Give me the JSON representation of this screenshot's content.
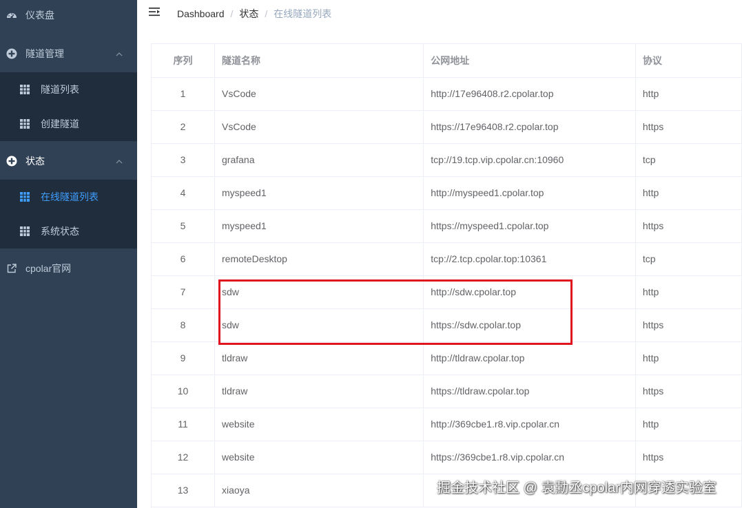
{
  "sidebar": {
    "dashboard": {
      "label": "仪表盘",
      "icon": "dashboard-icon"
    },
    "tunnel_mgmt": {
      "label": "隧道管理",
      "icon": "circle-plus-icon",
      "children": [
        {
          "label": "隧道列表",
          "icon": "table-icon"
        },
        {
          "label": "创建隧道",
          "icon": "table-icon"
        }
      ]
    },
    "status": {
      "label": "状态",
      "icon": "circle-plus-icon",
      "children": [
        {
          "label": "在线隧道列表",
          "icon": "table-icon",
          "active": true
        },
        {
          "label": "系统状态",
          "icon": "table-icon"
        }
      ]
    },
    "official": {
      "label": "cpolar官网",
      "icon": "external-link-icon"
    }
  },
  "header": {
    "breadcrumb": [
      "Dashboard",
      "状态",
      "在线隧道列表"
    ],
    "separator": "/"
  },
  "table": {
    "columns": [
      "序列",
      "隧道名称",
      "公网地址",
      "协议"
    ],
    "rows": [
      [
        "1",
        "VsCode",
        "http://17e96408.r2.cpolar.top",
        "http"
      ],
      [
        "2",
        "VsCode",
        "https://17e96408.r2.cpolar.top",
        "https"
      ],
      [
        "3",
        "grafana",
        "tcp://19.tcp.vip.cpolar.cn:10960",
        "tcp"
      ],
      [
        "4",
        "myspeed1",
        "http://myspeed1.cpolar.top",
        "http"
      ],
      [
        "5",
        "myspeed1",
        "https://myspeed1.cpolar.top",
        "https"
      ],
      [
        "6",
        "remoteDesktop",
        "tcp://2.tcp.cpolar.top:10361",
        "tcp"
      ],
      [
        "7",
        "sdw",
        "http://sdw.cpolar.top",
        "http"
      ],
      [
        "8",
        "sdw",
        "https://sdw.cpolar.top",
        "https"
      ],
      [
        "9",
        "tldraw",
        "http://tldraw.cpolar.top",
        "http"
      ],
      [
        "10",
        "tldraw",
        "https://tldraw.cpolar.top",
        "https"
      ],
      [
        "11",
        "website",
        "http://369cbe1.r8.vip.cpolar.cn",
        "http"
      ],
      [
        "12",
        "website",
        "https://369cbe1.r8.vip.cpolar.cn",
        "https"
      ],
      [
        "13",
        "xiaoya",
        "",
        ""
      ]
    ]
  },
  "watermark": "掘金技术社区 @ 袁勳丞cpolar内网穿透实验室",
  "colors": {
    "sidebar_bg": "#304156",
    "submenu_bg": "#1f2d3d",
    "active": "#409eff",
    "highlight": "#e0141e"
  }
}
